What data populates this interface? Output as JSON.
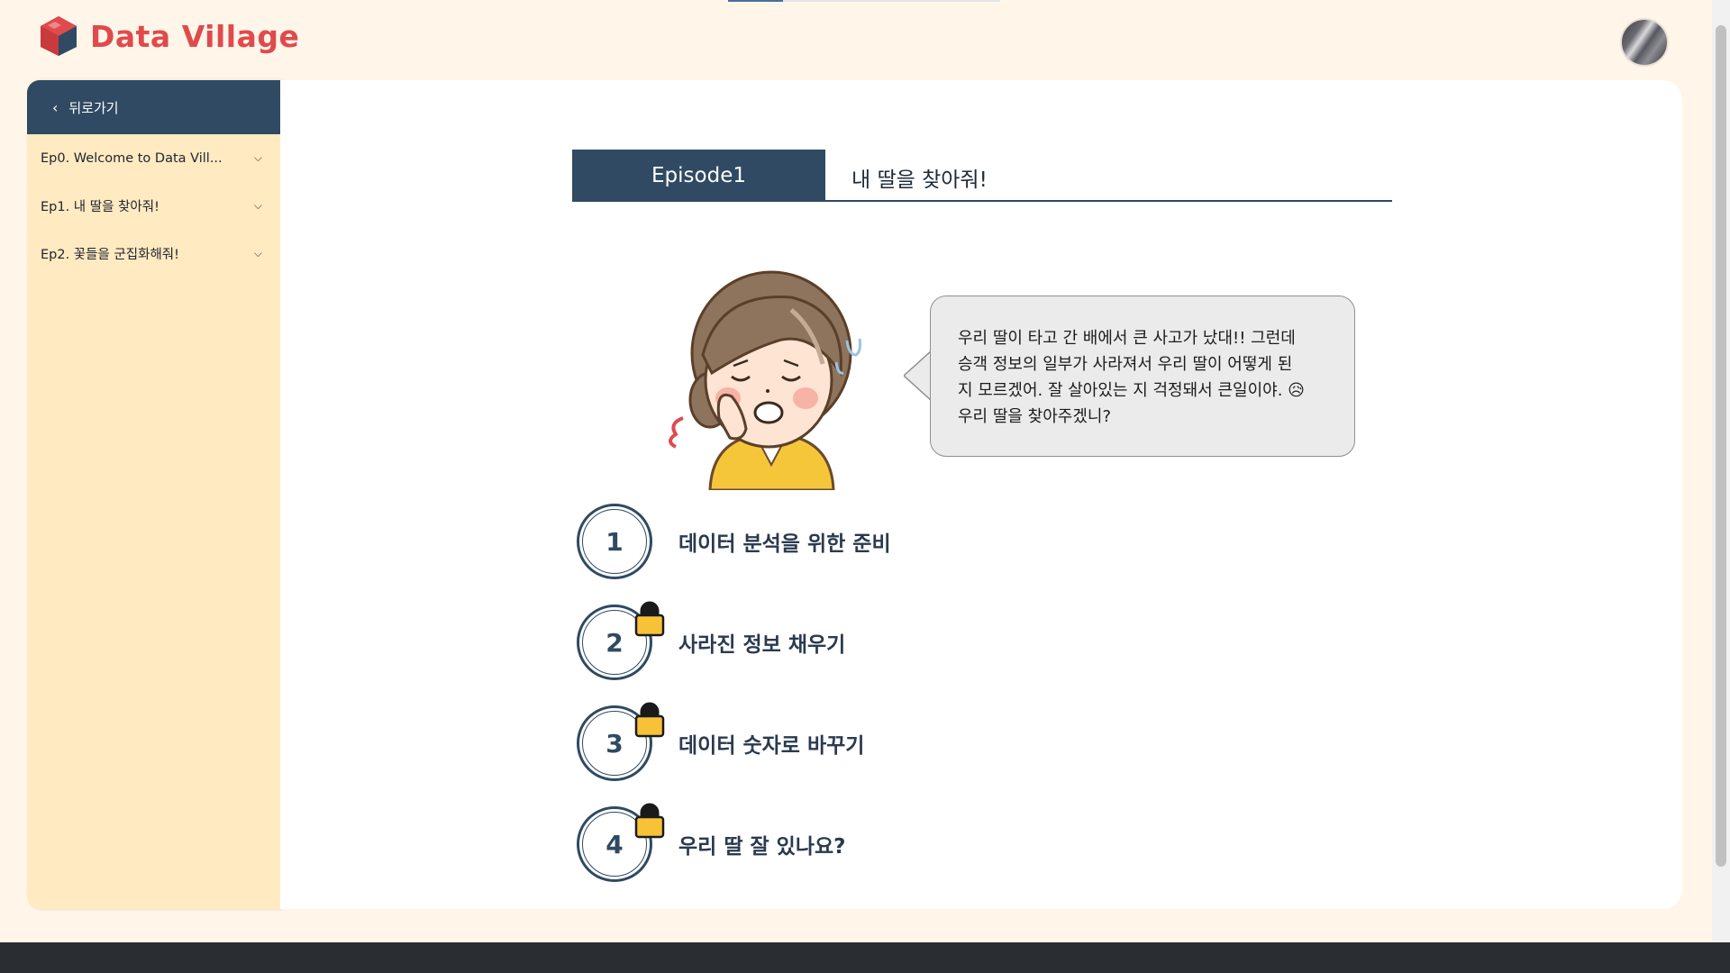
{
  "app": {
    "name": "Data Village"
  },
  "sidebar": {
    "back_label": "뒤로가기",
    "items": [
      {
        "label": "Ep0. Welcome to Data Vill..."
      },
      {
        "label": "Ep1. 내 딸을 찾아줘!"
      },
      {
        "label": "Ep2. 꽃들을 군집화해줘!"
      }
    ]
  },
  "episode": {
    "tag": "Episode1",
    "title": "내 딸을 찾아줘!"
  },
  "dialogue": {
    "line1": "우리 딸이 타고 간 배에서 큰 사고가 났대!! 그런데",
    "line2": "승객 정보의 일부가 사라져서 우리 딸이 어떻게 된",
    "line3": "지 모르겠어. 잘 살아있는 지 걱정돼서 큰일이야. 😥",
    "line4": "우리 딸을 찾아주겠니?"
  },
  "steps": [
    {
      "number": "1",
      "label": "데이터 분석을 위한 준비",
      "locked": false
    },
    {
      "number": "2",
      "label": "사라진 정보 채우기",
      "locked": true
    },
    {
      "number": "3",
      "label": "데이터 숫자로 바꾸기",
      "locked": true
    },
    {
      "number": "4",
      "label": "우리 딸 잘 있나요?",
      "locked": true
    }
  ],
  "colors": {
    "brand": "#e04a4d",
    "navy": "#2f4a62",
    "sidebar_bg": "#ffeac1",
    "page_bg": "#fff6e9",
    "lock": "#f7c237"
  },
  "icons": {
    "logo": "cube-logo-icon",
    "back": "chevron-left-icon",
    "expand": "chevron-down-icon",
    "lock": "padlock-icon"
  }
}
